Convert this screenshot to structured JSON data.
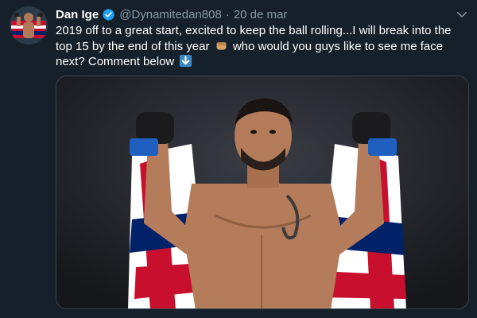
{
  "tweet": {
    "author_name": "Dan Ige",
    "handle": "@Dynamitedan808",
    "separator": "·",
    "date": "20 de mar",
    "text_part1": "2019 off to a great start, excited to keep the ball rolling...I will break into the top 15 by the end of this year",
    "text_part2": "who would you guys like to see me face next? Comment below"
  },
  "icons": {
    "verified": "verified-badge-icon",
    "caret": "chevron-down-icon",
    "fist_emoji": "fist-emoji",
    "down_arrow_emoji": "down-arrow-emoji"
  },
  "colors": {
    "background": "#15202b",
    "secondary_text": "#8899a6",
    "verified_blue": "#1da1f2",
    "media_border": "#38444d"
  }
}
